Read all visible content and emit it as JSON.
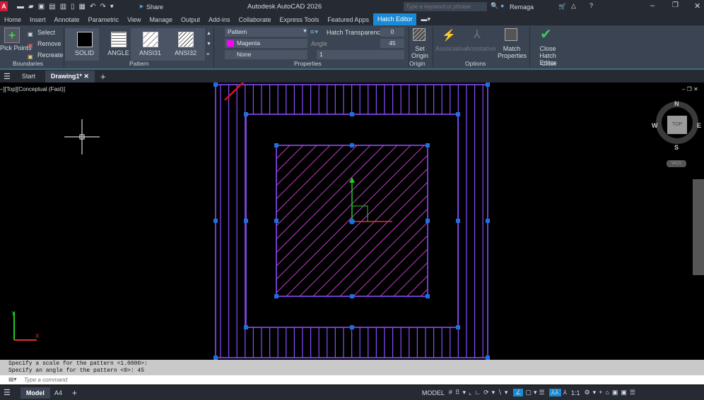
{
  "app": {
    "title": "Autodesk AutoCAD 2026",
    "logo": "A",
    "share": "Share",
    "search_placeholder": "Type a keyword or phrase",
    "user": "Remaga"
  },
  "menu": [
    "Home",
    "Insert",
    "Annotate",
    "Parametric",
    "View",
    "Manage",
    "Output",
    "Add-ins",
    "Collaborate",
    "Express Tools",
    "Featured Apps",
    "Hatch Editor"
  ],
  "ribbon": {
    "boundaries": {
      "pick_points": "Pick Points",
      "select": "Select",
      "remove": "Remove",
      "recreate": "Recreate",
      "label": "Boundaries"
    },
    "pattern": {
      "items": [
        "SOLID",
        "ANGLE",
        "ANSI31",
        "ANSI32"
      ],
      "label": "Pattern"
    },
    "properties": {
      "type": "Pattern",
      "color": "Magenta",
      "color_hex": "#ff00ff",
      "background": "None",
      "transparency_label": "Hatch Transparency",
      "transparency": "0",
      "angle_label": "Angle",
      "angle": "45",
      "scale": "1",
      "label": "Properties"
    },
    "origin": {
      "set_origin": "Set Origin",
      "label": "Origin"
    },
    "options": {
      "associative": "Associative",
      "annotative": "Annotative",
      "match": "Match Properties",
      "label": "Options"
    },
    "close": {
      "close": "Close Hatch Editor",
      "label": "Close"
    }
  },
  "doc_tabs": {
    "start": "Start",
    "drawing": "Drawing1*"
  },
  "viewport": {
    "label": "–][Top][Conceptual (Fast)]",
    "viewcube": {
      "n": "N",
      "s": "S",
      "e": "E",
      "w": "W",
      "top": "TOP",
      "wcs": "WCS"
    }
  },
  "command": {
    "history": [
      "Specify a scale for the pattern <1.0000>:",
      "Specify an angle for the pattern <0>: 45"
    ],
    "placeholder": "Type a command"
  },
  "status": {
    "model_tab": "Model",
    "layout_tab": "A4",
    "model": "MODEL",
    "scale": "1:1"
  },
  "colors": {
    "accent": "#1a8ad4",
    "hatch": "#8a4dff",
    "magenta": "#c03cc8",
    "grip": "#1e6fe0",
    "arrow": "#e01010"
  }
}
